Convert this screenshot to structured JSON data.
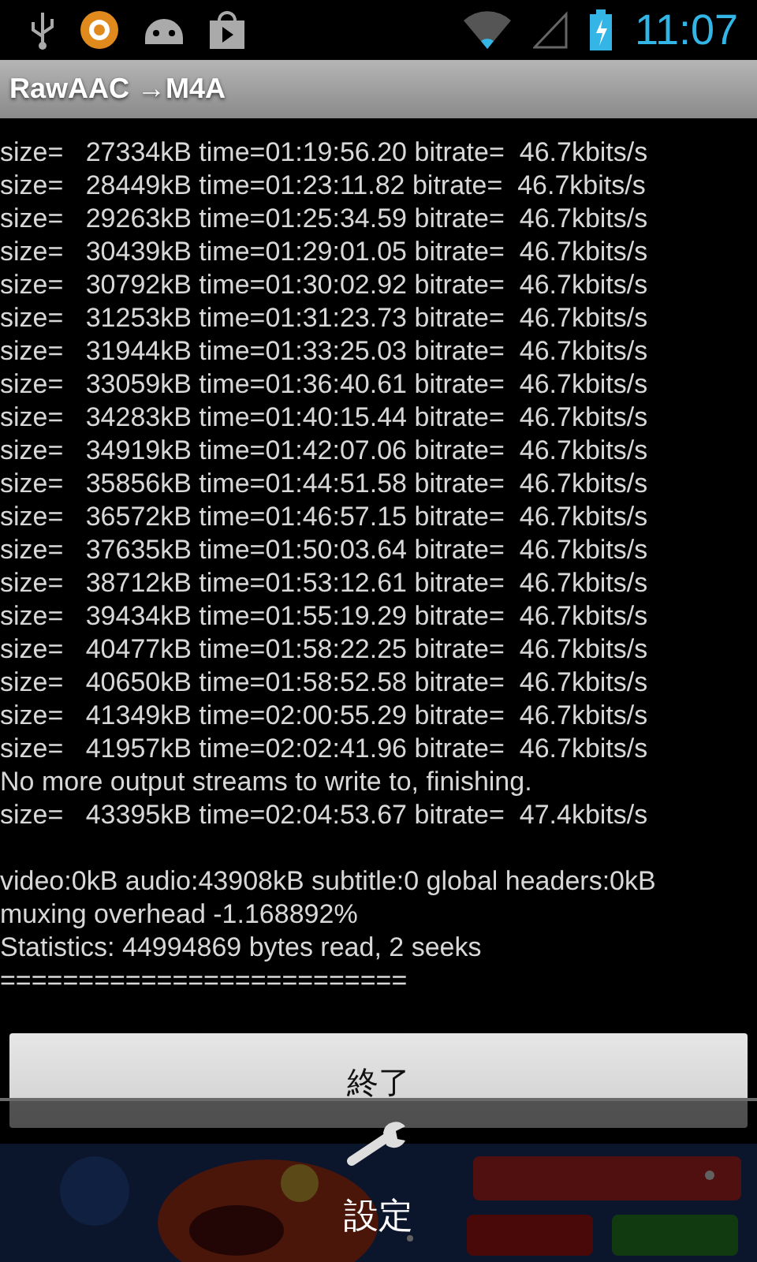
{
  "status_bar": {
    "time": "11:07"
  },
  "title": "RawAAC →M4A",
  "log_blocks": [
    {
      "lines": [
        "size=   27334kB time=01:19:56.20 bitrate=  46.7kbits/s",
        "size=   28449kB time=01:23:11.82 bitrate=  46.7kbits/s",
        "size=   29263kB time=01:25:34.59 bitrate=  46.7kbits/s",
        "size=   30439kB time=01:29:01.05 bitrate=  46.7kbits/s",
        "size=   30792kB time=01:30:02.92 bitrate=  46.7kbits/s",
        "size=   31253kB time=01:31:23.73 bitrate=  46.7kbits/s",
        "size=   31944kB time=01:33:25.03 bitrate=  46.7kbits/s",
        "size=   33059kB time=01:36:40.61 bitrate=  46.7kbits/s",
        "size=   34283kB time=01:40:15.44 bitrate=  46.7kbits/s",
        "size=   34919kB time=01:42:07.06 bitrate=  46.7kbits/s",
        "size=   35856kB time=01:44:51.58 bitrate=  46.7kbits/s",
        "size=   36572kB time=01:46:57.15 bitrate=  46.7kbits/s",
        "size=   37635kB time=01:50:03.64 bitrate=  46.7kbits/s",
        "size=   38712kB time=01:53:12.61 bitrate=  46.7kbits/s",
        "size=   39434kB time=01:55:19.29 bitrate=  46.7kbits/s",
        "size=   40477kB time=01:58:22.25 bitrate=  46.7kbits/s",
        "size=   40650kB time=01:58:52.58 bitrate=  46.7kbits/s",
        "size=   41349kB time=02:00:55.29 bitrate=  46.7kbits/s",
        "size=   41957kB time=02:02:41.96 bitrate=  46.7kbits/s",
        "No more output streams to write to, finishing.",
        "size=   43395kB time=02:04:53.67 bitrate=  47.4kbits/s"
      ]
    },
    {
      "lines": [
        "video:0kB audio:43908kB subtitle:0 global headers:0kB",
        "muxing overhead -1.168892%",
        "Statistics: 44994869 bytes read, 2 seeks",
        "=========================="
      ]
    }
  ],
  "finish_button": "終了",
  "menu": {
    "items": [
      {
        "label": "設定"
      }
    ]
  }
}
